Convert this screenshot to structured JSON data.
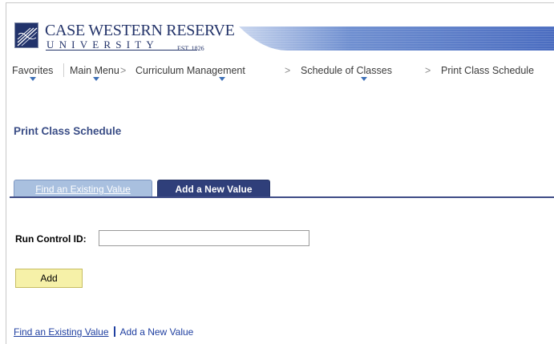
{
  "branding": {
    "name_top": "CASE WESTERN RESERVE",
    "name_bottom": "UNIVERSITY",
    "established": "EST. 1826",
    "logo_icon": "university-seal-icon"
  },
  "nav": {
    "items": [
      {
        "label": "Favorites",
        "has_menu": true
      },
      {
        "label": "Main Menu",
        "has_menu": true
      },
      {
        "label": "Curriculum Management",
        "has_menu": true
      },
      {
        "label": "Schedule of Classes",
        "has_menu": true
      },
      {
        "label": "Print Class Schedule",
        "has_menu": false
      }
    ],
    "separator": ">"
  },
  "page": {
    "title": "Print Class Schedule"
  },
  "tabs": [
    {
      "label": "Find an Existing Value",
      "active": false
    },
    {
      "label": "Add a New Value",
      "active": true
    }
  ],
  "form": {
    "run_control_label": "Run Control ID:",
    "run_control_value": "",
    "add_button": "Add"
  },
  "footer_links": {
    "find": "Find an Existing Value",
    "add": "Add a New Value"
  },
  "colors": {
    "brand_navy": "#24346a",
    "tab_active": "#2f3f7a",
    "tab_inactive": "#a9c0df",
    "title": "#3a4d86",
    "link": "#1f3fa0",
    "button_bg": "#f6f1a8"
  }
}
